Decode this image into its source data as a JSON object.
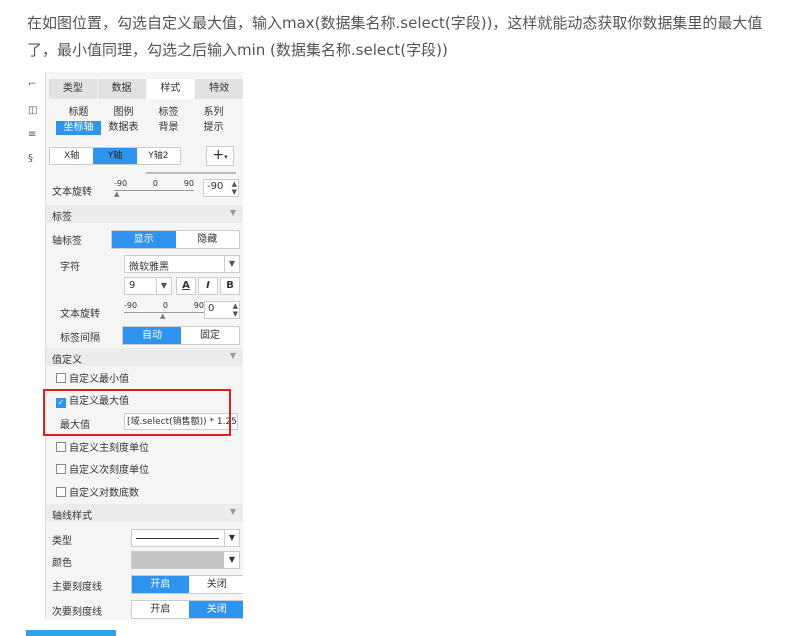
{
  "intro_text": "在如图位置，勾选自定义最大值，输入max(数据集名称.select(字段))，这样就能动态获取你数据集里的最大值了，最小值同理，勾选之后输入min (数据集名称.select(字段))",
  "left_strip_icons": [
    "frame-icon",
    "clock-icon",
    "list-icon",
    "link-icon"
  ],
  "tabs": [
    {
      "label": "类型",
      "active": false
    },
    {
      "label": "数据",
      "active": false
    },
    {
      "label": "样式",
      "active": true
    },
    {
      "label": "特效",
      "active": false
    }
  ],
  "subtabs": [
    {
      "label": "标题",
      "active": false
    },
    {
      "label": "图例",
      "active": false
    },
    {
      "label": "标签",
      "active": false
    },
    {
      "label": "系列",
      "active": false
    },
    {
      "label": "坐标轴",
      "active": true
    },
    {
      "label": "数据表",
      "active": false
    },
    {
      "label": "背景",
      "active": false
    },
    {
      "label": "提示",
      "active": false
    }
  ],
  "axis_tabs": [
    {
      "label": "X轴",
      "active": false
    },
    {
      "label": "Y轴",
      "active": true
    },
    {
      "label": "Y轴2",
      "active": false
    }
  ],
  "add_button": "+",
  "text_rotate_top": {
    "label": "文本旋转",
    "min": "-90",
    "mid": "0",
    "max": "90",
    "value": "-90"
  },
  "label_section": {
    "title": "标签",
    "collapse": "▼"
  },
  "axis_label": {
    "label": "轴标签",
    "options": [
      "显示",
      "隐藏"
    ],
    "selected": "显示"
  },
  "font": {
    "label": "字符",
    "family": "微软雅黑",
    "size": "9",
    "buttons": [
      "A",
      "I",
      "B"
    ]
  },
  "text_rotate_label": {
    "label": "文本旋转",
    "min": "-90",
    "mid": "0",
    "max": "90",
    "value": "0"
  },
  "label_interval": {
    "label": "标签间隔",
    "options": [
      "自动",
      "固定"
    ],
    "selected": "自动"
  },
  "value_section": {
    "title": "值定义",
    "collapse": "▼"
  },
  "custom_min": {
    "label": "自定义最小值",
    "checked": false
  },
  "custom_max": {
    "label": "自定义最大值",
    "checked": true
  },
  "max_value": {
    "label": "最大值",
    "value": "[域.select(销售额)) * 1.25"
  },
  "custom_major_unit": {
    "label": "自定义主刻度单位",
    "checked": false
  },
  "custom_minor_unit": {
    "label": "自定义次刻度单位",
    "checked": false
  },
  "custom_log_base": {
    "label": "自定义对数底数",
    "checked": false
  },
  "axis_style_section": {
    "title": "轴线样式",
    "collapse": "▼"
  },
  "line_type": {
    "label": "类型"
  },
  "line_color": {
    "label": "颜色",
    "color": "#c4c4c4"
  },
  "major_tick": {
    "label": "主要刻度线",
    "options": [
      "开启",
      "关闭"
    ],
    "selected": "开启"
  },
  "minor_tick": {
    "label": "次要刻度线",
    "options": [
      "开启",
      "关闭"
    ],
    "selected": "关闭"
  }
}
